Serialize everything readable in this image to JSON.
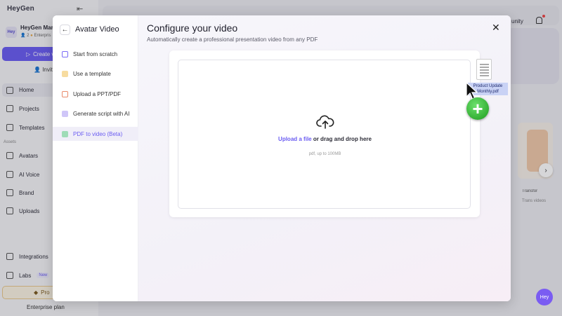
{
  "app": {
    "logo": "HeyGen",
    "workspace": {
      "avatar_text": "Hey",
      "name": "HeyGen Mark",
      "members": "2",
      "plan_tag": "Enterpris"
    },
    "create_label": "Create v",
    "invite_label": "Invit",
    "nav": [
      {
        "label": "Home"
      },
      {
        "label": "Projects"
      },
      {
        "label": "Templates"
      },
      {
        "label": "Avatars"
      },
      {
        "label": "AI Voice"
      },
      {
        "label": "Brand"
      },
      {
        "label": "Uploads"
      },
      {
        "label": "Integrations"
      },
      {
        "label": "Labs"
      }
    ],
    "nav_section": "Assets",
    "labs_badge": "New",
    "upgrade_label": "Pro",
    "plan_label": "Enterprise plan",
    "community_label": "unity",
    "card": {
      "title": "Transfor",
      "subtitle": "Trans videos"
    },
    "chat_label": "Hey"
  },
  "modal": {
    "side_title": "Avatar Video",
    "options": [
      {
        "label": "Start from scratch",
        "color": "#7b6cf6"
      },
      {
        "label": "Use a template",
        "color": "#f2c46a"
      },
      {
        "label": "Upload a PPT/PDF",
        "color": "#e98b6b"
      },
      {
        "label": "Generate script with AI",
        "color": "#a695f5"
      },
      {
        "label": "PDF to video (Beta)",
        "color": "#67c98d"
      }
    ],
    "active_option": 4,
    "title": "Configure your video",
    "subtitle": "Automatically create a professional presentation video from any PDF",
    "dropzone": {
      "link_text": "Upload a file",
      "rest_text": " or drag and drop here",
      "hint": "pdf, up to 100MB"
    }
  },
  "drag": {
    "file_label": "Product Update Monthly.pdf"
  }
}
